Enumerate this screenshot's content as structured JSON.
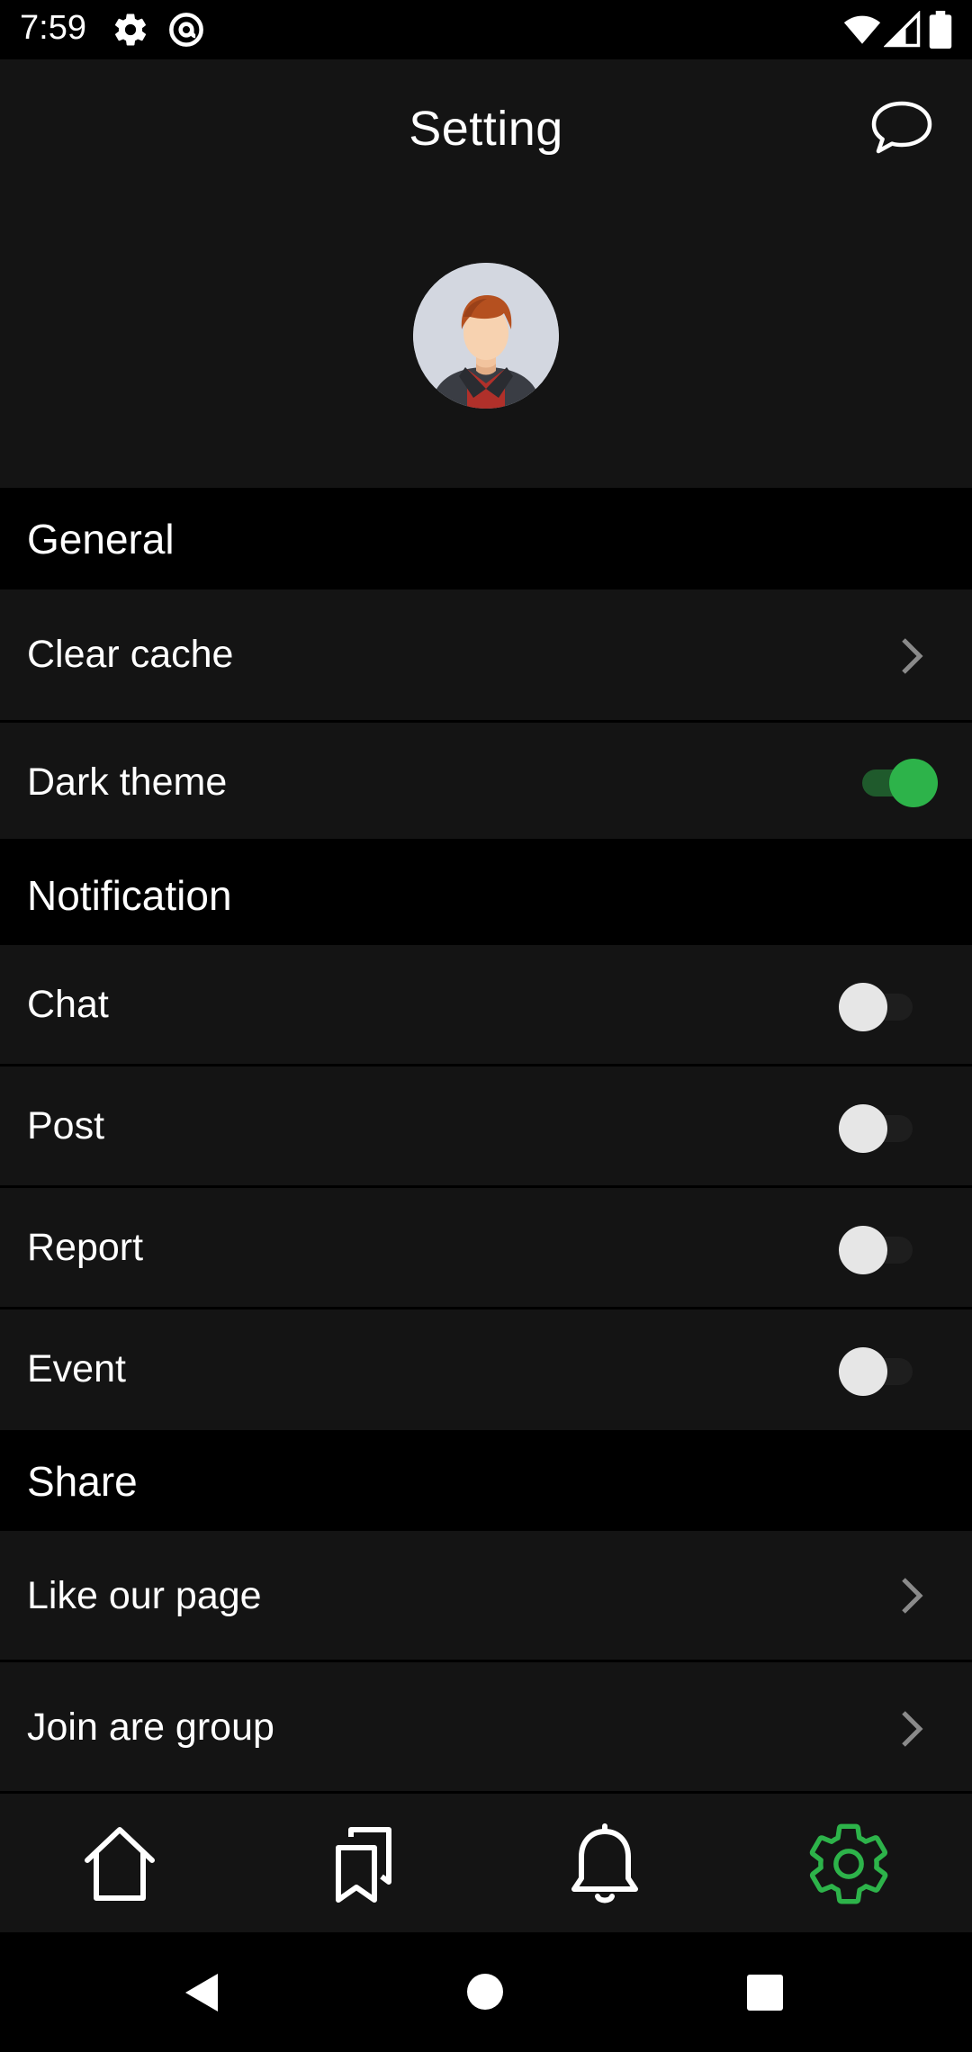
{
  "status_bar": {
    "time": "7:59",
    "left_icons": [
      "gear-icon",
      "at-sign-icon"
    ],
    "right_icons": [
      "wifi-icon",
      "signal-icon",
      "battery-icon"
    ]
  },
  "header": {
    "title": "Setting",
    "chat_icon": "chat-bubble-icon",
    "avatar": "user-avatar"
  },
  "sections": {
    "general": {
      "title": "General",
      "clear_cache": "Clear cache",
      "dark_theme": "Dark theme",
      "dark_theme_on": true
    },
    "notification": {
      "title": "Notification",
      "chat": "Chat",
      "chat_on": false,
      "post": "Post",
      "post_on": false,
      "report": "Report",
      "report_on": false,
      "event": "Event",
      "event_on": false
    },
    "share": {
      "title": "Share",
      "like_page": "Like our page",
      "join_group": "Join are group"
    }
  },
  "bottom_nav": {
    "items": [
      "home-icon",
      "bookmarks-icon",
      "bell-icon",
      "settings-icon"
    ],
    "active": "settings-icon"
  },
  "colors": {
    "accent": "#2db34a",
    "background": "#141414",
    "section_bg": "#000000",
    "toggle_off_thumb": "#e6e6e6"
  }
}
